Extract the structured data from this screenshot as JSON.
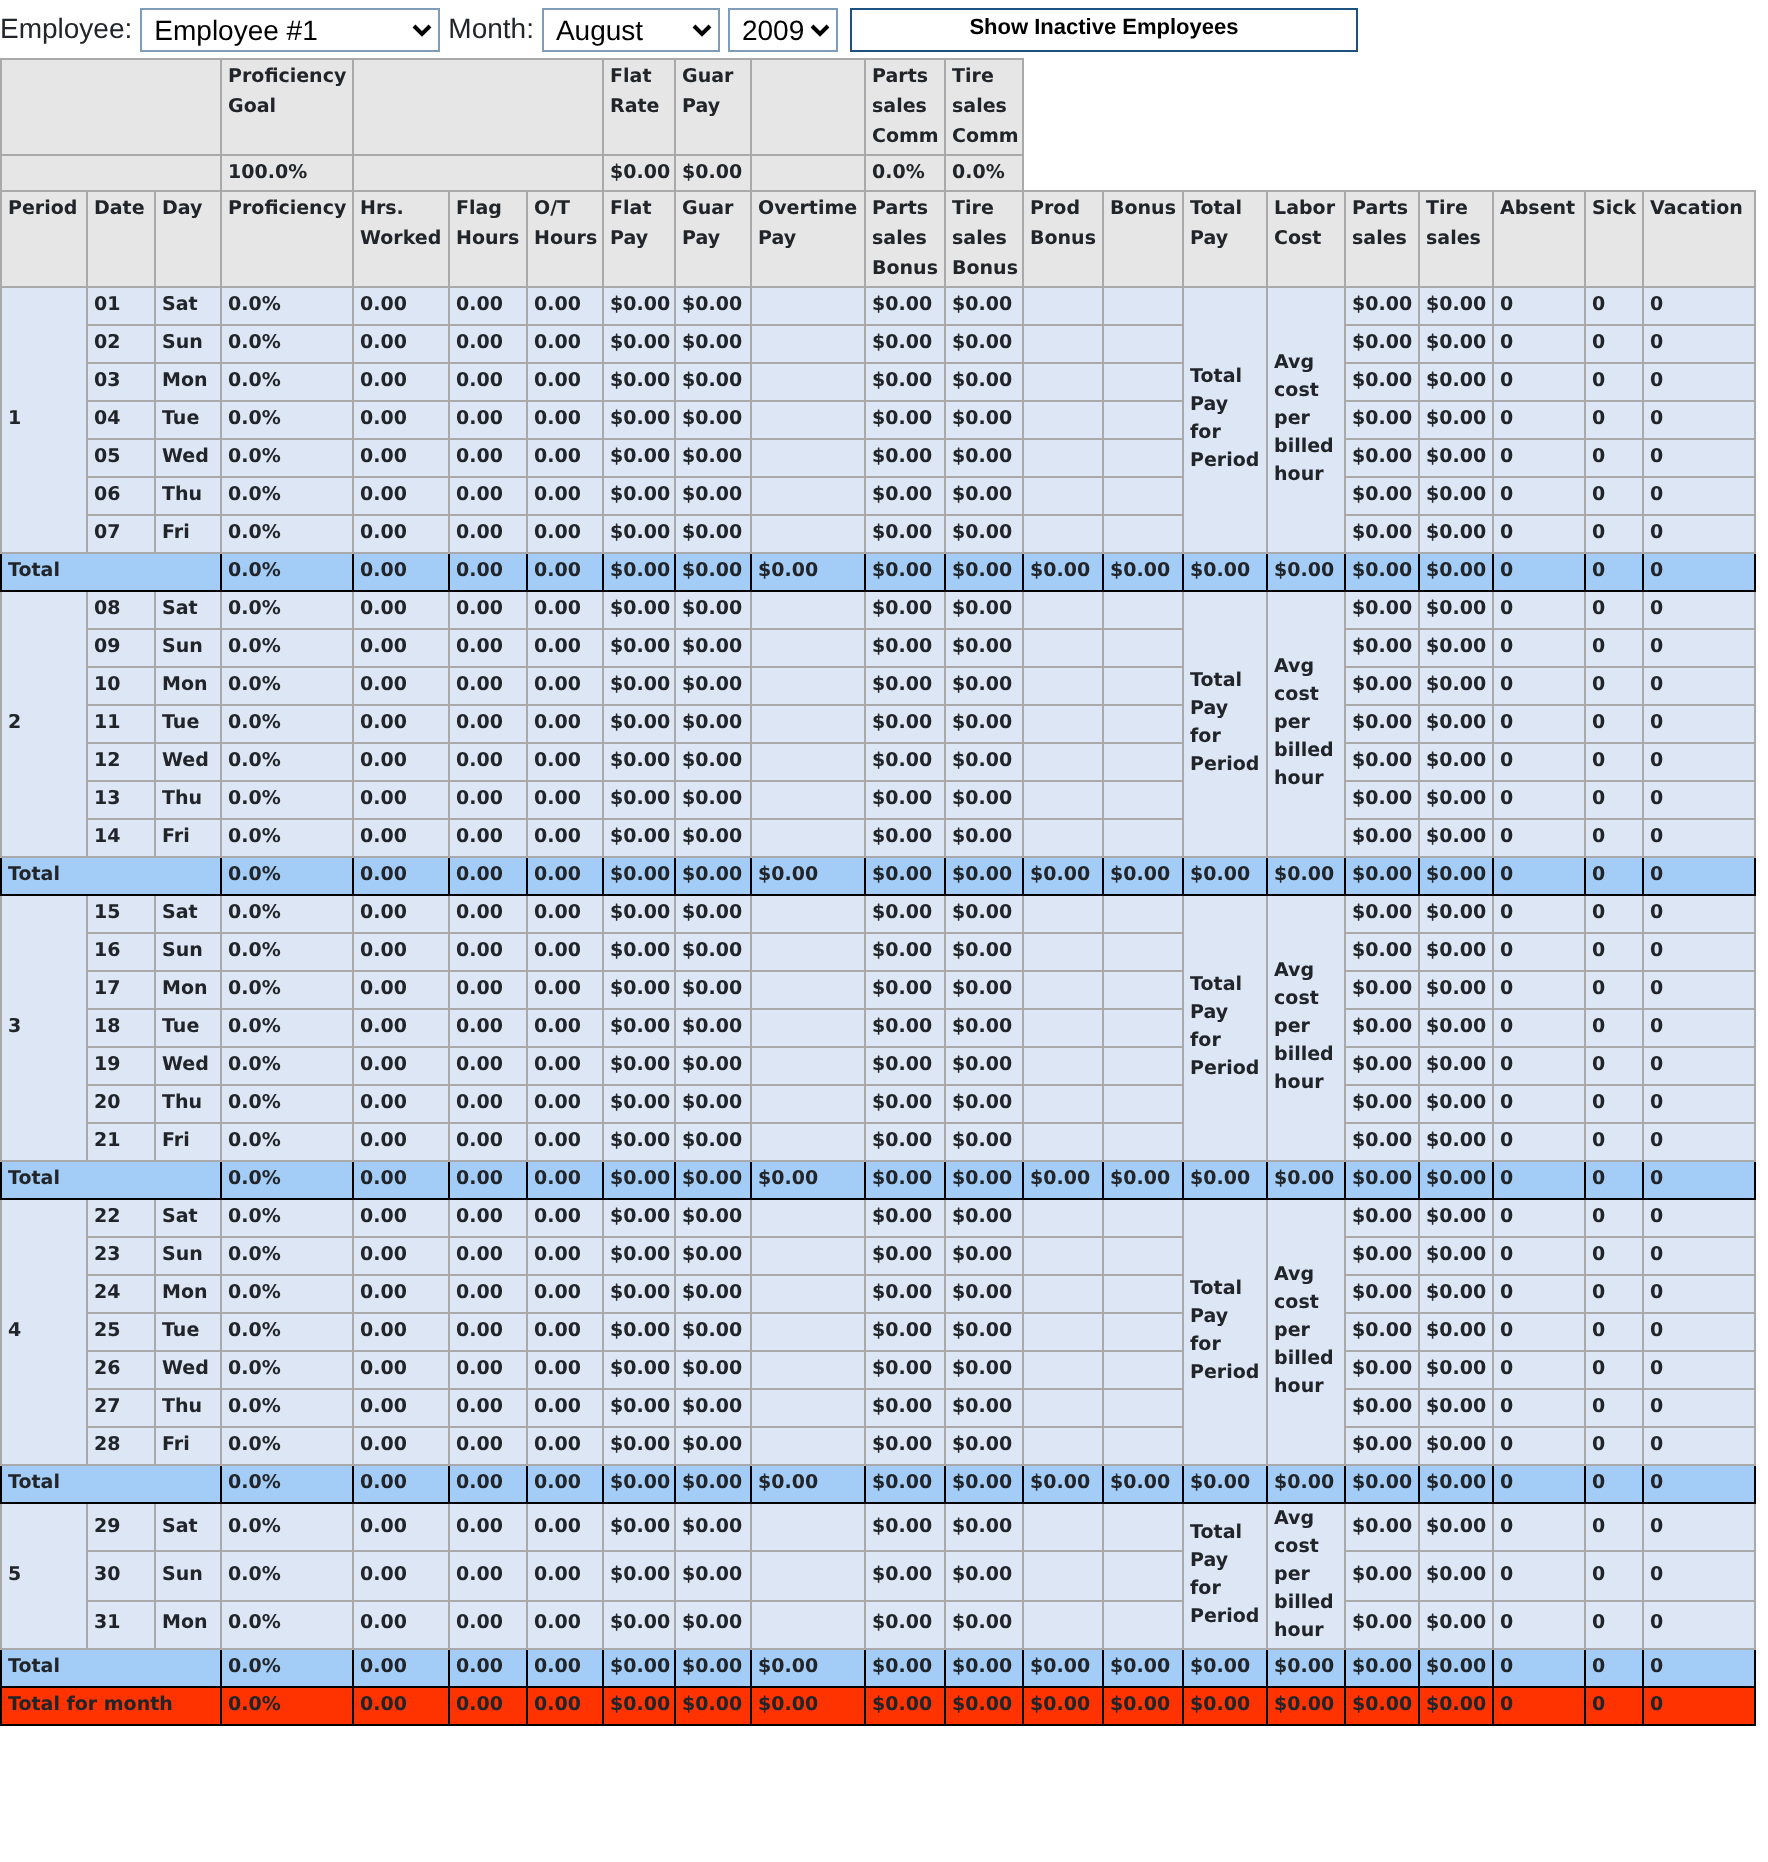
{
  "filters": {
    "employee_label": "Employee:",
    "employee": "Employee #1",
    "month_label": "Month:",
    "month": "August",
    "year": "2009",
    "button": "Show Inactive Employees"
  },
  "goal_header": {
    "labels": [
      "Proficiency Goal",
      "Flat Rate",
      "Guar Pay",
      "Parts sales Comm",
      "Tire sales Comm"
    ],
    "values": [
      "100.0%",
      "$0.00",
      "$0.00",
      "0.0%",
      "0.0%"
    ]
  },
  "columns": [
    "Period",
    "Date",
    "Day",
    "Proficiency",
    "Hrs. Worked",
    "Flag Hours",
    "O/T Hours",
    "Flat Pay",
    "Guar Pay",
    "Overtime Pay",
    "Parts sales Bonus",
    "Tire sales Bonus",
    "Prod Bonus",
    "Bonus",
    "Total Pay",
    "Labor Cost",
    "Parts sales",
    "Tire sales",
    "Absent",
    "Sick",
    "Vacation"
  ],
  "periods": [
    {
      "label": "1",
      "total_pay_note": "Total Pay for Period",
      "labor_cost_note": "Avg cost per billed hour",
      "days": [
        {
          "date": "01",
          "day": "Sat",
          "values": [
            "0.0%",
            "0.00",
            "0.00",
            "0.00",
            "$0.00",
            "$0.00",
            "$0.00",
            "$0.00",
            "$0.00",
            "$0.00",
            "0",
            "0",
            "0"
          ]
        },
        {
          "date": "02",
          "day": "Sun",
          "values": [
            "0.0%",
            "0.00",
            "0.00",
            "0.00",
            "$0.00",
            "$0.00",
            "$0.00",
            "$0.00",
            "$0.00",
            "$0.00",
            "0",
            "0",
            "0"
          ]
        },
        {
          "date": "03",
          "day": "Mon",
          "values": [
            "0.0%",
            "0.00",
            "0.00",
            "0.00",
            "$0.00",
            "$0.00",
            "$0.00",
            "$0.00",
            "$0.00",
            "$0.00",
            "0",
            "0",
            "0"
          ]
        },
        {
          "date": "04",
          "day": "Tue",
          "values": [
            "0.0%",
            "0.00",
            "0.00",
            "0.00",
            "$0.00",
            "$0.00",
            "$0.00",
            "$0.00",
            "$0.00",
            "$0.00",
            "0",
            "0",
            "0"
          ]
        },
        {
          "date": "05",
          "day": "Wed",
          "values": [
            "0.0%",
            "0.00",
            "0.00",
            "0.00",
            "$0.00",
            "$0.00",
            "$0.00",
            "$0.00",
            "$0.00",
            "$0.00",
            "0",
            "0",
            "0"
          ]
        },
        {
          "date": "06",
          "day": "Thu",
          "values": [
            "0.0%",
            "0.00",
            "0.00",
            "0.00",
            "$0.00",
            "$0.00",
            "$0.00",
            "$0.00",
            "$0.00",
            "$0.00",
            "0",
            "0",
            "0"
          ]
        },
        {
          "date": "07",
          "day": "Fri",
          "values": [
            "0.0%",
            "0.00",
            "0.00",
            "0.00",
            "$0.00",
            "$0.00",
            "$0.00",
            "$0.00",
            "$0.00",
            "$0.00",
            "0",
            "0",
            "0"
          ]
        }
      ],
      "total": {
        "label": "Total",
        "values": [
          "0.0%",
          "0.00",
          "0.00",
          "0.00",
          "$0.00",
          "$0.00",
          "$0.00",
          "$0.00",
          "$0.00",
          "$0.00",
          "$0.00",
          "$0.00",
          "$0.00",
          "$0.00",
          "$0.00",
          "0",
          "0",
          "0"
        ]
      }
    },
    {
      "label": "2",
      "total_pay_note": "Total Pay for Period",
      "labor_cost_note": "Avg cost per billed hour",
      "days": [
        {
          "date": "08",
          "day": "Sat",
          "values": [
            "0.0%",
            "0.00",
            "0.00",
            "0.00",
            "$0.00",
            "$0.00",
            "$0.00",
            "$0.00",
            "$0.00",
            "$0.00",
            "0",
            "0",
            "0"
          ]
        },
        {
          "date": "09",
          "day": "Sun",
          "values": [
            "0.0%",
            "0.00",
            "0.00",
            "0.00",
            "$0.00",
            "$0.00",
            "$0.00",
            "$0.00",
            "$0.00",
            "$0.00",
            "0",
            "0",
            "0"
          ]
        },
        {
          "date": "10",
          "day": "Mon",
          "values": [
            "0.0%",
            "0.00",
            "0.00",
            "0.00",
            "$0.00",
            "$0.00",
            "$0.00",
            "$0.00",
            "$0.00",
            "$0.00",
            "0",
            "0",
            "0"
          ]
        },
        {
          "date": "11",
          "day": "Tue",
          "values": [
            "0.0%",
            "0.00",
            "0.00",
            "0.00",
            "$0.00",
            "$0.00",
            "$0.00",
            "$0.00",
            "$0.00",
            "$0.00",
            "0",
            "0",
            "0"
          ]
        },
        {
          "date": "12",
          "day": "Wed",
          "values": [
            "0.0%",
            "0.00",
            "0.00",
            "0.00",
            "$0.00",
            "$0.00",
            "$0.00",
            "$0.00",
            "$0.00",
            "$0.00",
            "0",
            "0",
            "0"
          ]
        },
        {
          "date": "13",
          "day": "Thu",
          "values": [
            "0.0%",
            "0.00",
            "0.00",
            "0.00",
            "$0.00",
            "$0.00",
            "$0.00",
            "$0.00",
            "$0.00",
            "$0.00",
            "0",
            "0",
            "0"
          ]
        },
        {
          "date": "14",
          "day": "Fri",
          "values": [
            "0.0%",
            "0.00",
            "0.00",
            "0.00",
            "$0.00",
            "$0.00",
            "$0.00",
            "$0.00",
            "$0.00",
            "$0.00",
            "0",
            "0",
            "0"
          ]
        }
      ],
      "total": {
        "label": "Total",
        "values": [
          "0.0%",
          "0.00",
          "0.00",
          "0.00",
          "$0.00",
          "$0.00",
          "$0.00",
          "$0.00",
          "$0.00",
          "$0.00",
          "$0.00",
          "$0.00",
          "$0.00",
          "$0.00",
          "$0.00",
          "0",
          "0",
          "0"
        ]
      }
    },
    {
      "label": "3",
      "total_pay_note": "Total Pay for Period",
      "labor_cost_note": "Avg cost per billed hour",
      "days": [
        {
          "date": "15",
          "day": "Sat",
          "values": [
            "0.0%",
            "0.00",
            "0.00",
            "0.00",
            "$0.00",
            "$0.00",
            "$0.00",
            "$0.00",
            "$0.00",
            "$0.00",
            "0",
            "0",
            "0"
          ]
        },
        {
          "date": "16",
          "day": "Sun",
          "values": [
            "0.0%",
            "0.00",
            "0.00",
            "0.00",
            "$0.00",
            "$0.00",
            "$0.00",
            "$0.00",
            "$0.00",
            "$0.00",
            "0",
            "0",
            "0"
          ]
        },
        {
          "date": "17",
          "day": "Mon",
          "values": [
            "0.0%",
            "0.00",
            "0.00",
            "0.00",
            "$0.00",
            "$0.00",
            "$0.00",
            "$0.00",
            "$0.00",
            "$0.00",
            "0",
            "0",
            "0"
          ]
        },
        {
          "date": "18",
          "day": "Tue",
          "values": [
            "0.0%",
            "0.00",
            "0.00",
            "0.00",
            "$0.00",
            "$0.00",
            "$0.00",
            "$0.00",
            "$0.00",
            "$0.00",
            "0",
            "0",
            "0"
          ]
        },
        {
          "date": "19",
          "day": "Wed",
          "values": [
            "0.0%",
            "0.00",
            "0.00",
            "0.00",
            "$0.00",
            "$0.00",
            "$0.00",
            "$0.00",
            "$0.00",
            "$0.00",
            "0",
            "0",
            "0"
          ]
        },
        {
          "date": "20",
          "day": "Thu",
          "values": [
            "0.0%",
            "0.00",
            "0.00",
            "0.00",
            "$0.00",
            "$0.00",
            "$0.00",
            "$0.00",
            "$0.00",
            "$0.00",
            "0",
            "0",
            "0"
          ]
        },
        {
          "date": "21",
          "day": "Fri",
          "values": [
            "0.0%",
            "0.00",
            "0.00",
            "0.00",
            "$0.00",
            "$0.00",
            "$0.00",
            "$0.00",
            "$0.00",
            "$0.00",
            "0",
            "0",
            "0"
          ]
        }
      ],
      "total": {
        "label": "Total",
        "values": [
          "0.0%",
          "0.00",
          "0.00",
          "0.00",
          "$0.00",
          "$0.00",
          "$0.00",
          "$0.00",
          "$0.00",
          "$0.00",
          "$0.00",
          "$0.00",
          "$0.00",
          "$0.00",
          "$0.00",
          "0",
          "0",
          "0"
        ]
      }
    },
    {
      "label": "4",
      "total_pay_note": "Total Pay for Period",
      "labor_cost_note": "Avg cost per billed hour",
      "days": [
        {
          "date": "22",
          "day": "Sat",
          "values": [
            "0.0%",
            "0.00",
            "0.00",
            "0.00",
            "$0.00",
            "$0.00",
            "$0.00",
            "$0.00",
            "$0.00",
            "$0.00",
            "0",
            "0",
            "0"
          ]
        },
        {
          "date": "23",
          "day": "Sun",
          "values": [
            "0.0%",
            "0.00",
            "0.00",
            "0.00",
            "$0.00",
            "$0.00",
            "$0.00",
            "$0.00",
            "$0.00",
            "$0.00",
            "0",
            "0",
            "0"
          ]
        },
        {
          "date": "24",
          "day": "Mon",
          "values": [
            "0.0%",
            "0.00",
            "0.00",
            "0.00",
            "$0.00",
            "$0.00",
            "$0.00",
            "$0.00",
            "$0.00",
            "$0.00",
            "0",
            "0",
            "0"
          ]
        },
        {
          "date": "25",
          "day": "Tue",
          "values": [
            "0.0%",
            "0.00",
            "0.00",
            "0.00",
            "$0.00",
            "$0.00",
            "$0.00",
            "$0.00",
            "$0.00",
            "$0.00",
            "0",
            "0",
            "0"
          ]
        },
        {
          "date": "26",
          "day": "Wed",
          "values": [
            "0.0%",
            "0.00",
            "0.00",
            "0.00",
            "$0.00",
            "$0.00",
            "$0.00",
            "$0.00",
            "$0.00",
            "$0.00",
            "0",
            "0",
            "0"
          ]
        },
        {
          "date": "27",
          "day": "Thu",
          "values": [
            "0.0%",
            "0.00",
            "0.00",
            "0.00",
            "$0.00",
            "$0.00",
            "$0.00",
            "$0.00",
            "$0.00",
            "$0.00",
            "0",
            "0",
            "0"
          ]
        },
        {
          "date": "28",
          "day": "Fri",
          "values": [
            "0.0%",
            "0.00",
            "0.00",
            "0.00",
            "$0.00",
            "$0.00",
            "$0.00",
            "$0.00",
            "$0.00",
            "$0.00",
            "0",
            "0",
            "0"
          ]
        }
      ],
      "total": {
        "label": "Total",
        "values": [
          "0.0%",
          "0.00",
          "0.00",
          "0.00",
          "$0.00",
          "$0.00",
          "$0.00",
          "$0.00",
          "$0.00",
          "$0.00",
          "$0.00",
          "$0.00",
          "$0.00",
          "$0.00",
          "$0.00",
          "0",
          "0",
          "0"
        ]
      }
    },
    {
      "label": "5",
      "total_pay_note": "Total Pay for Period",
      "labor_cost_note": "Avg cost per billed hour",
      "days": [
        {
          "date": "29",
          "day": "Sat",
          "values": [
            "0.0%",
            "0.00",
            "0.00",
            "0.00",
            "$0.00",
            "$0.00",
            "$0.00",
            "$0.00",
            "$0.00",
            "$0.00",
            "0",
            "0",
            "0"
          ]
        },
        {
          "date": "30",
          "day": "Sun",
          "values": [
            "0.0%",
            "0.00",
            "0.00",
            "0.00",
            "$0.00",
            "$0.00",
            "$0.00",
            "$0.00",
            "$0.00",
            "$0.00",
            "0",
            "0",
            "0"
          ]
        },
        {
          "date": "31",
          "day": "Mon",
          "values": [
            "0.0%",
            "0.00",
            "0.00",
            "0.00",
            "$0.00",
            "$0.00",
            "$0.00",
            "$0.00",
            "$0.00",
            "$0.00",
            "0",
            "0",
            "0"
          ]
        }
      ],
      "total": {
        "label": "Total",
        "values": [
          "0.0%",
          "0.00",
          "0.00",
          "0.00",
          "$0.00",
          "$0.00",
          "$0.00",
          "$0.00",
          "$0.00",
          "$0.00",
          "$0.00",
          "$0.00",
          "$0.00",
          "$0.00",
          "$0.00",
          "0",
          "0",
          "0"
        ]
      }
    }
  ],
  "month_total": {
    "label": "Total for month",
    "values": [
      "0.0%",
      "0.00",
      "0.00",
      "0.00",
      "$0.00",
      "$0.00",
      "$0.00",
      "$0.00",
      "$0.00",
      "$0.00",
      "$0.00",
      "$0.00",
      "$0.00",
      "$0.00",
      "$0.00",
      "0",
      "0",
      "0"
    ]
  }
}
